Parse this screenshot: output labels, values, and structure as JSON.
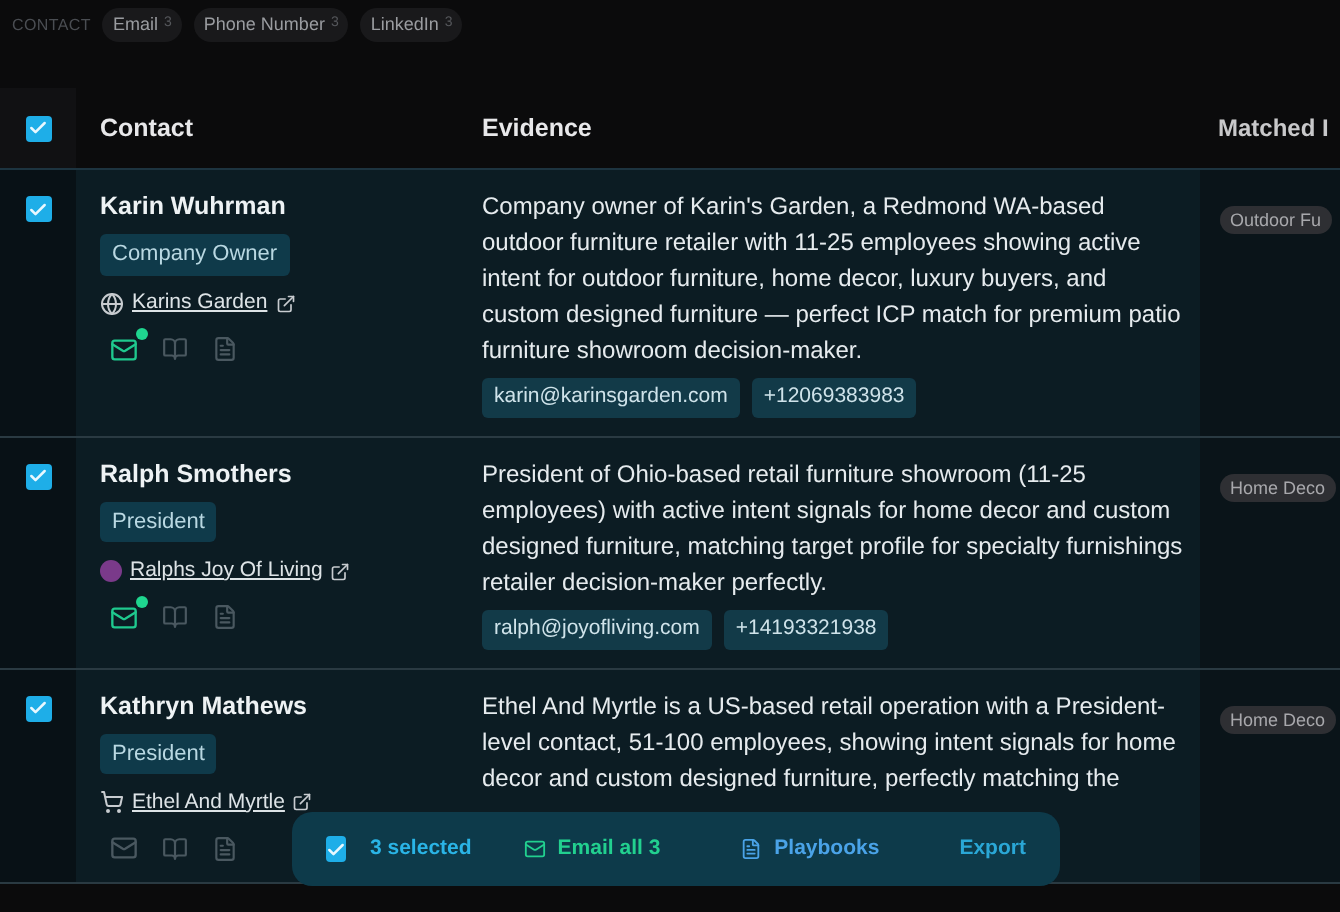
{
  "filter_bar": {
    "label": "CONTACT",
    "chips": [
      {
        "label": "Email",
        "count": "3"
      },
      {
        "label": "Phone Number",
        "count": "3"
      },
      {
        "label": "LinkedIn",
        "count": "3"
      }
    ]
  },
  "table": {
    "all_checked": true,
    "columns": [
      "Contact",
      "Evidence",
      "Matched I"
    ],
    "rows": [
      {
        "checked": true,
        "name": "Karin Wuhrman",
        "title": "Company Owner",
        "company": {
          "name": "Karins Garden",
          "kind": "globe"
        },
        "email_sent": true,
        "evidence": "Company owner of Karin's Garden, a Redmond WA-based outdoor furniture retailer with 11-25 employees showing active intent for outdoor furniture, home decor, luxury buyers, and custom designed furniture — perfect ICP match for premium patio furniture showroom decision-maker.",
        "chips": [
          "karin@karinsgarden.com",
          "+12069383983"
        ],
        "matched": "Outdoor Fu"
      },
      {
        "checked": true,
        "name": "Ralph Smothers",
        "title": "President",
        "company": {
          "name": "Ralphs Joy Of Living",
          "kind": "logo"
        },
        "email_sent": true,
        "evidence": "President of Ohio-based retail furniture showroom (11-25 employees) with active intent signals for home decor and custom designed furniture, matching target profile for specialty furnishings retailer decision-maker perfectly.",
        "chips": [
          "ralph@joyofliving.com",
          "+14193321938"
        ],
        "matched": "Home Deco"
      },
      {
        "checked": true,
        "name": "Kathryn Mathews",
        "title": "President",
        "company": {
          "name": "Ethel And Myrtle",
          "kind": "cart"
        },
        "email_sent": false,
        "evidence": "Ethel And Myrtle is a US-based retail operation with a President-level contact, 51-100 employees, showing intent signals for home decor and custom designed furniture, perfectly matching the",
        "chips": [],
        "matched": "Home Deco"
      }
    ]
  },
  "action_bar": {
    "checked": true,
    "selected": "3 selected",
    "email": "Email all 3",
    "playbooks": "Playbooks",
    "export": "Export"
  }
}
